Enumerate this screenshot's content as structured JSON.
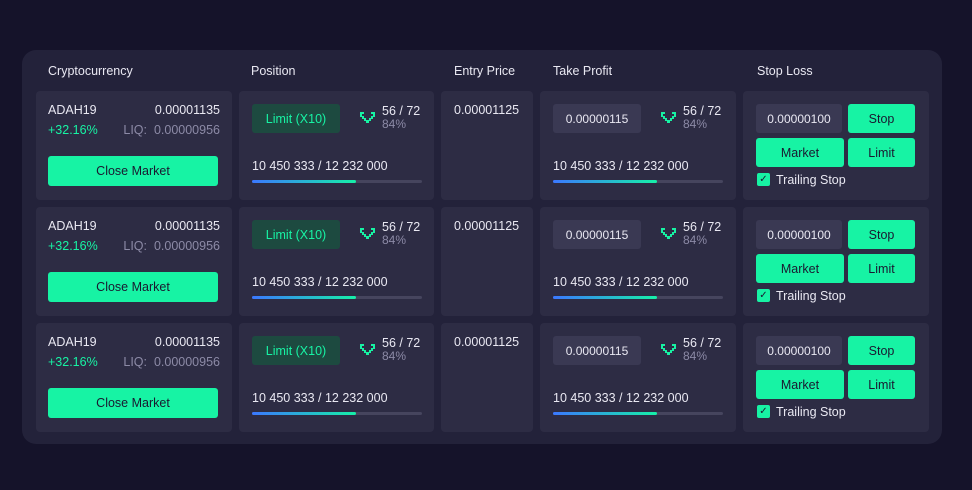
{
  "headers": {
    "cryptocurrency": "Cryptocurrency",
    "position": "Position",
    "entry_price": "Entry Price",
    "take_profit": "Take Profit",
    "stop_loss": "Stop Loss"
  },
  "rows": [
    {
      "symbol": "ADAH19",
      "price": "0.00001135",
      "change": "+32.16%",
      "liq_label": "LIQ:",
      "liq_value": "0.00000956",
      "close_label": "Close Market",
      "position": {
        "limit_label": "Limit (X10)",
        "ratio": "56 / 72",
        "pct": "84%",
        "qty": "10 450 333 / 12 232 000",
        "progress": 0.61
      },
      "entry_price": "0.00001125",
      "take_profit": {
        "value": "0.00000115",
        "ratio": "56 / 72",
        "pct": "84%",
        "qty": "10 450 333 / 12 232 000",
        "progress": 0.61
      },
      "stop_loss": {
        "value": "0.00000100",
        "stop_label": "Stop",
        "market_label": "Market",
        "limit_label": "Limit",
        "trailing_label": "Trailing Stop",
        "trailing_checked": true
      }
    },
    {
      "symbol": "ADAH19",
      "price": "0.00001135",
      "change": "+32.16%",
      "liq_label": "LIQ:",
      "liq_value": "0.00000956",
      "close_label": "Close Market",
      "position": {
        "limit_label": "Limit (X10)",
        "ratio": "56 / 72",
        "pct": "84%",
        "qty": "10 450 333 / 12 232 000",
        "progress": 0.61
      },
      "entry_price": "0.00001125",
      "take_profit": {
        "value": "0.00000115",
        "ratio": "56 / 72",
        "pct": "84%",
        "qty": "10 450 333 / 12 232 000",
        "progress": 0.61
      },
      "stop_loss": {
        "value": "0.00000100",
        "stop_label": "Stop",
        "market_label": "Market",
        "limit_label": "Limit",
        "trailing_label": "Trailing Stop",
        "trailing_checked": true
      }
    },
    {
      "symbol": "ADAH19",
      "price": "0.00001135",
      "change": "+32.16%",
      "liq_label": "LIQ:",
      "liq_value": "0.00000956",
      "close_label": "Close Market",
      "position": {
        "limit_label": "Limit (X10)",
        "ratio": "56 / 72",
        "pct": "84%",
        "qty": "10 450 333 / 12 232 000",
        "progress": 0.61
      },
      "entry_price": "0.00001125",
      "take_profit": {
        "value": "0.00000115",
        "ratio": "56 / 72",
        "pct": "84%",
        "qty": "10 450 333 / 12 232 000",
        "progress": 0.61
      },
      "stop_loss": {
        "value": "0.00000100",
        "stop_label": "Stop",
        "market_label": "Market",
        "limit_label": "Limit",
        "trailing_label": "Trailing Stop",
        "trailing_checked": true
      }
    }
  ],
  "colors": {
    "background": "#15132a",
    "panel": "#23223a",
    "cell": "#2d2c44",
    "accent": "#17f3a4",
    "progress_start": "#3b78ff"
  },
  "icons": {
    "ratio_icon": "pixel-heart-icon",
    "checkbox_icon": "check-icon"
  }
}
